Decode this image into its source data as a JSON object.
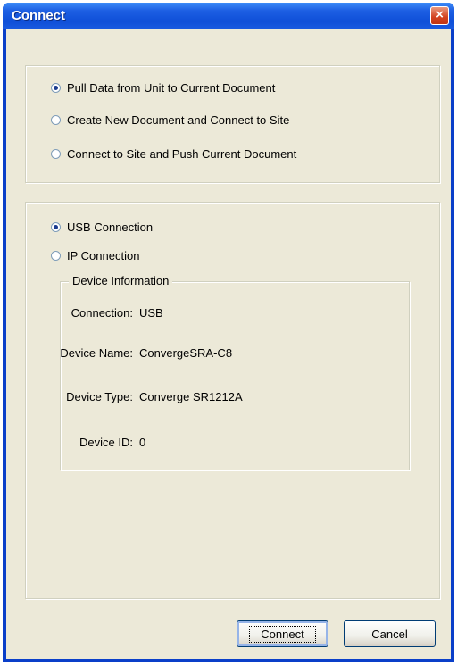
{
  "window": {
    "title": "Connect",
    "close_label": "×"
  },
  "mode_group": {
    "options": [
      {
        "label": "Pull Data from Unit to Current Document",
        "checked": true
      },
      {
        "label": "Create New Document and Connect to Site",
        "checked": false
      },
      {
        "label": "Connect to Site and Push Current Document",
        "checked": false
      }
    ]
  },
  "connection_group": {
    "options": [
      {
        "label": "USB Connection",
        "checked": true
      },
      {
        "label": "IP Connection",
        "checked": false
      }
    ],
    "device_info": {
      "legend": "Device Information",
      "rows": [
        {
          "label": "Connection:",
          "value": "USB"
        },
        {
          "label": "Device Name:",
          "value": "ConvergeSRA-C8"
        },
        {
          "label": "Device Type:",
          "value": "Converge SR1212A"
        },
        {
          "label": "Device ID:",
          "value": "0"
        }
      ]
    }
  },
  "buttons": {
    "connect": "Connect",
    "cancel": "Cancel"
  }
}
